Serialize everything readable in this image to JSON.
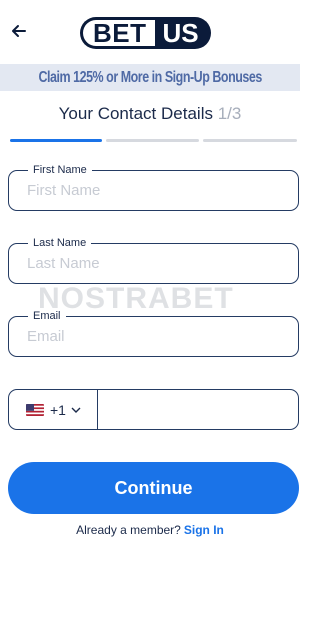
{
  "header": {
    "logo_left": "BET",
    "logo_right": "US"
  },
  "promo": {
    "text": "Claim 125% or More in Sign-Up Bonuses"
  },
  "step": {
    "title": "Your Contact Details",
    "count": "1/3",
    "progress_current": 1,
    "progress_total": 3
  },
  "form": {
    "first_name": {
      "label": "First Name",
      "placeholder": "First Name"
    },
    "last_name": {
      "label": "Last Name",
      "placeholder": "Last Name"
    },
    "email": {
      "label": "Email",
      "placeholder": "Email"
    },
    "phone": {
      "country_code": "+1",
      "value": ""
    }
  },
  "watermark": "NOSTRABET",
  "actions": {
    "continue_label": "Continue"
  },
  "footer": {
    "prompt": "Already a member?",
    "link": "Sign In"
  },
  "colors": {
    "accent": "#1a73e8",
    "navy": "#0b1b3a",
    "promo_bg": "#e3e8f2"
  },
  "icons": {
    "back": "arrow-left-icon",
    "flag": "us-flag-icon",
    "dropdown": "chevron-down-icon"
  }
}
